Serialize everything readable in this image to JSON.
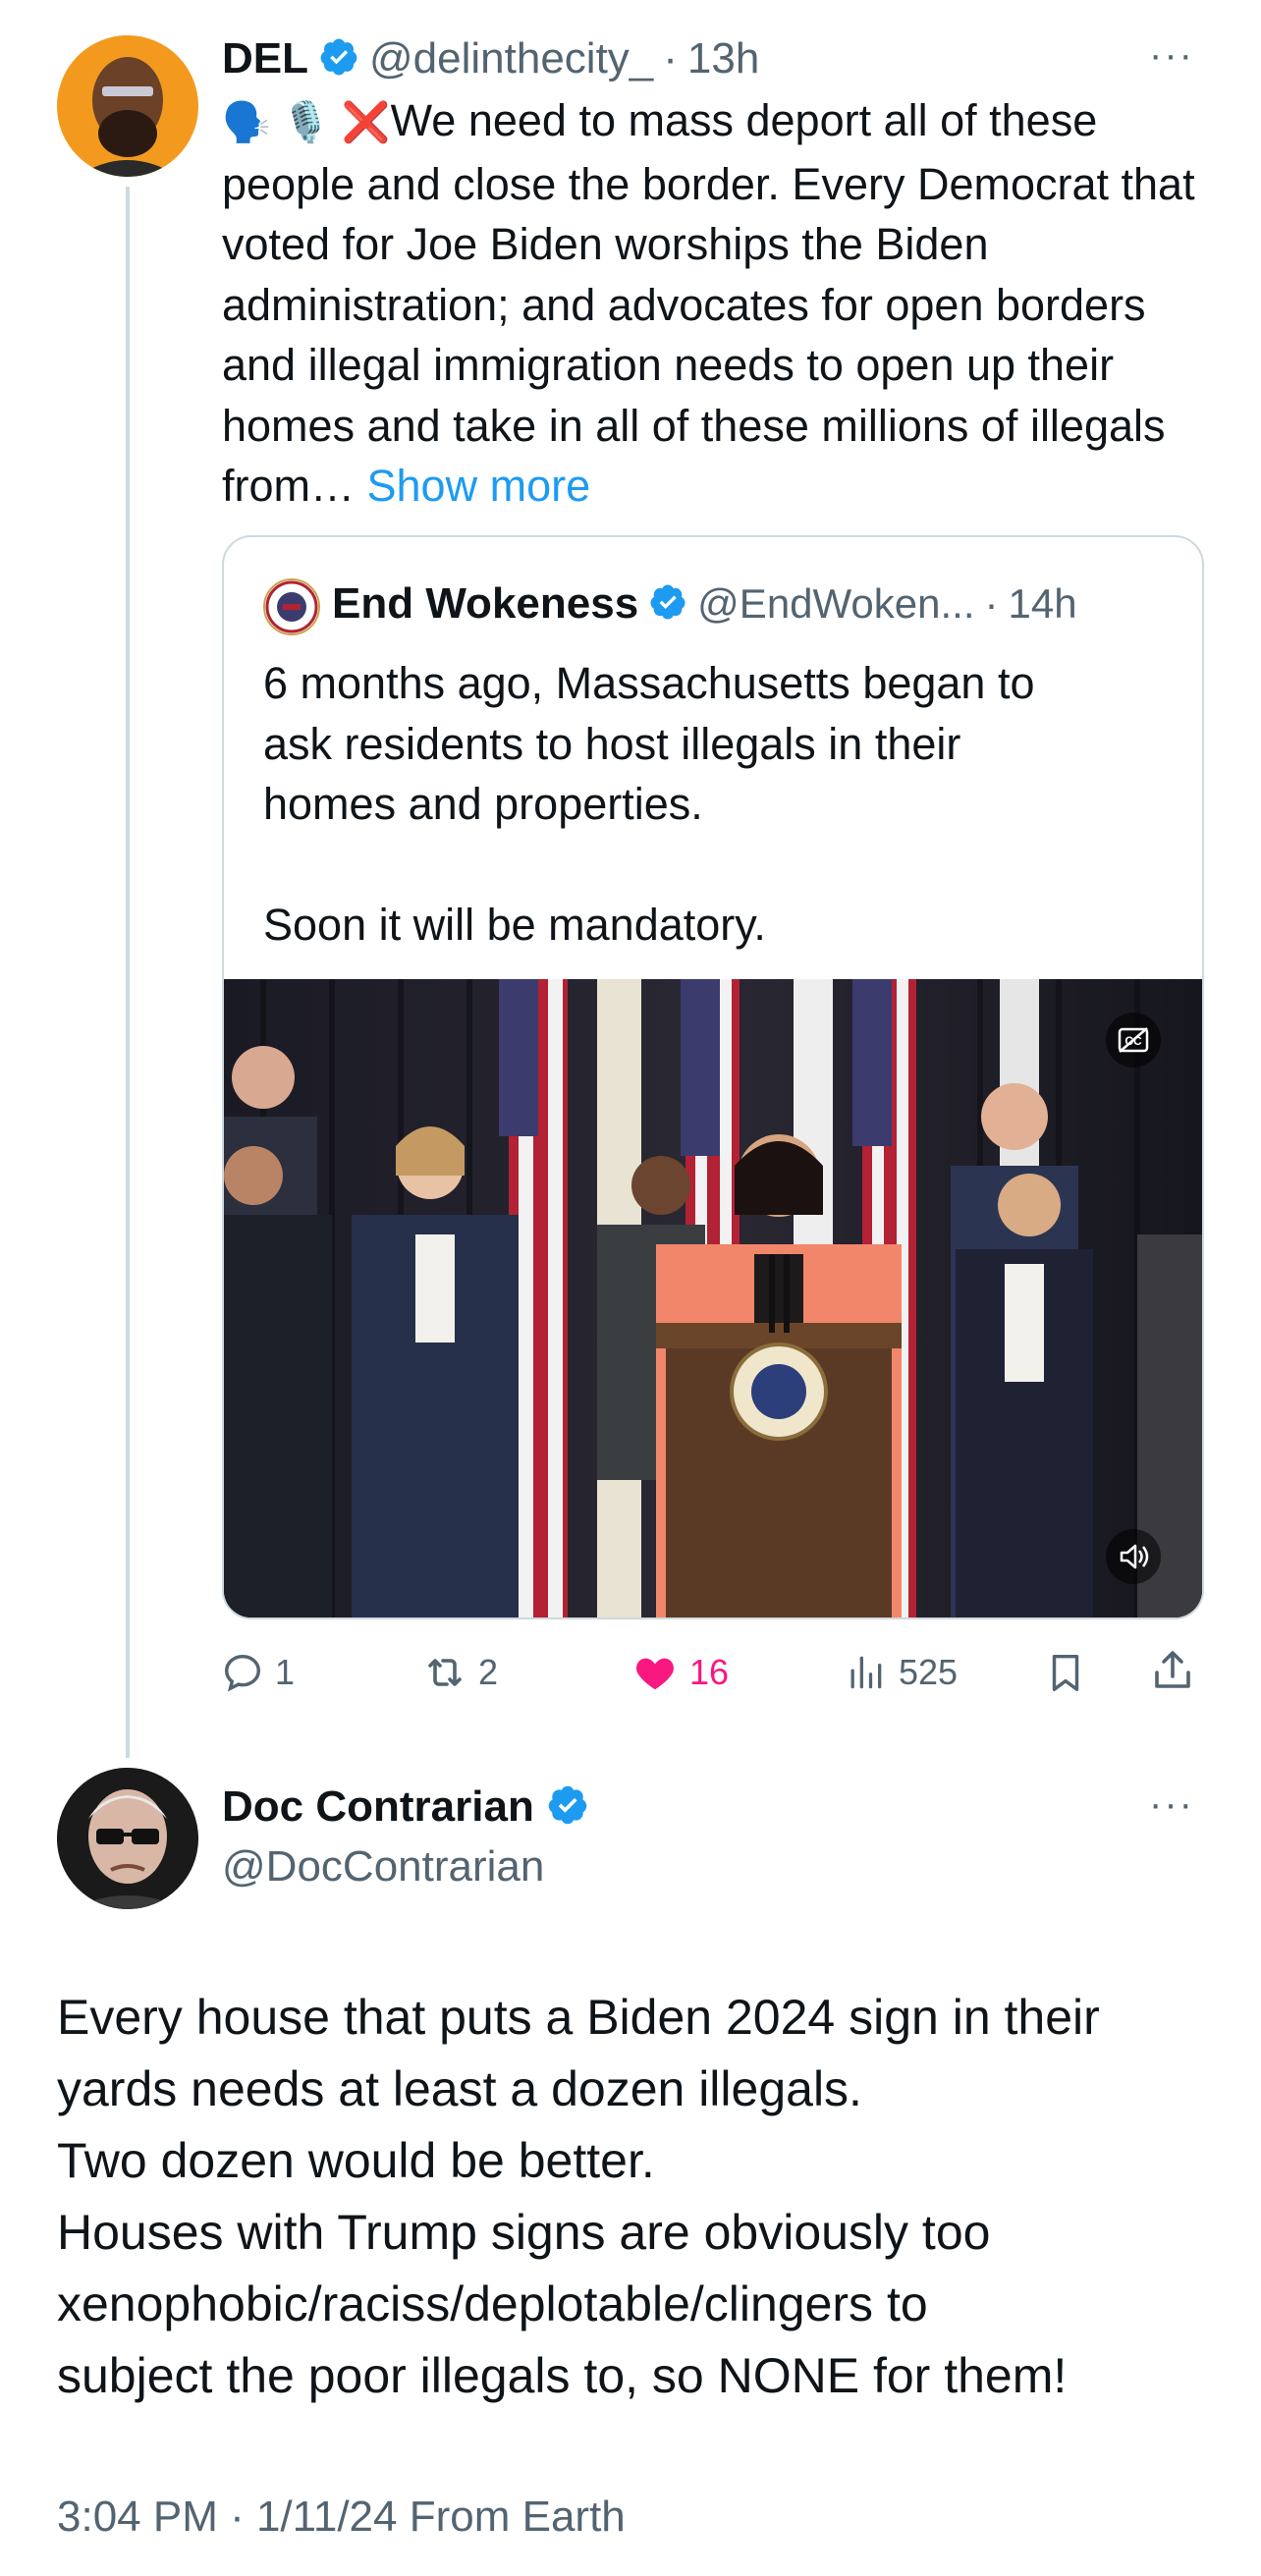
{
  "tweet1": {
    "name": "DEL",
    "handle": "@delinthecity_",
    "time": "13h",
    "emojis": "🗣️ 🎙️ ❌",
    "text": "We need to mass deport all of these people and close the border. Every Democrat that voted for Joe Biden worships the Biden administration; and advocates for open borders and illegal immigration needs to open up their homes and take in all of these millions of illegals from…",
    "show_more": "Show more",
    "more_label": "···"
  },
  "quote": {
    "name": "End Wokeness",
    "handle": "@EndWoken...",
    "time": "14h",
    "text": "6 months ago, Massachusetts began to\nask residents to host illegals in their\nhomes and properties.\n\nSoon it will be mandatory."
  },
  "actions": {
    "replies": "1",
    "reposts": "2",
    "likes": "16",
    "views": "525"
  },
  "tweet2": {
    "name": "Doc Contrarian",
    "handle": "@DocContrarian",
    "text": "Every house that puts a Biden 2024 sign in their\nyards needs at least a dozen illegals.\nTwo dozen would be better.\nHouses with Trump signs are obviously too\nxenophobic/raciss/deplotable/clingers to\nsubject the poor illegals to, so NONE for them!",
    "timestamp": "3:04 PM · 1/11/24 From Earth",
    "more_label": "···"
  },
  "colors": {
    "verified": "#1d9bf0",
    "like": "#f91880",
    "link": "#1d9bf0",
    "muted": "#536471"
  }
}
